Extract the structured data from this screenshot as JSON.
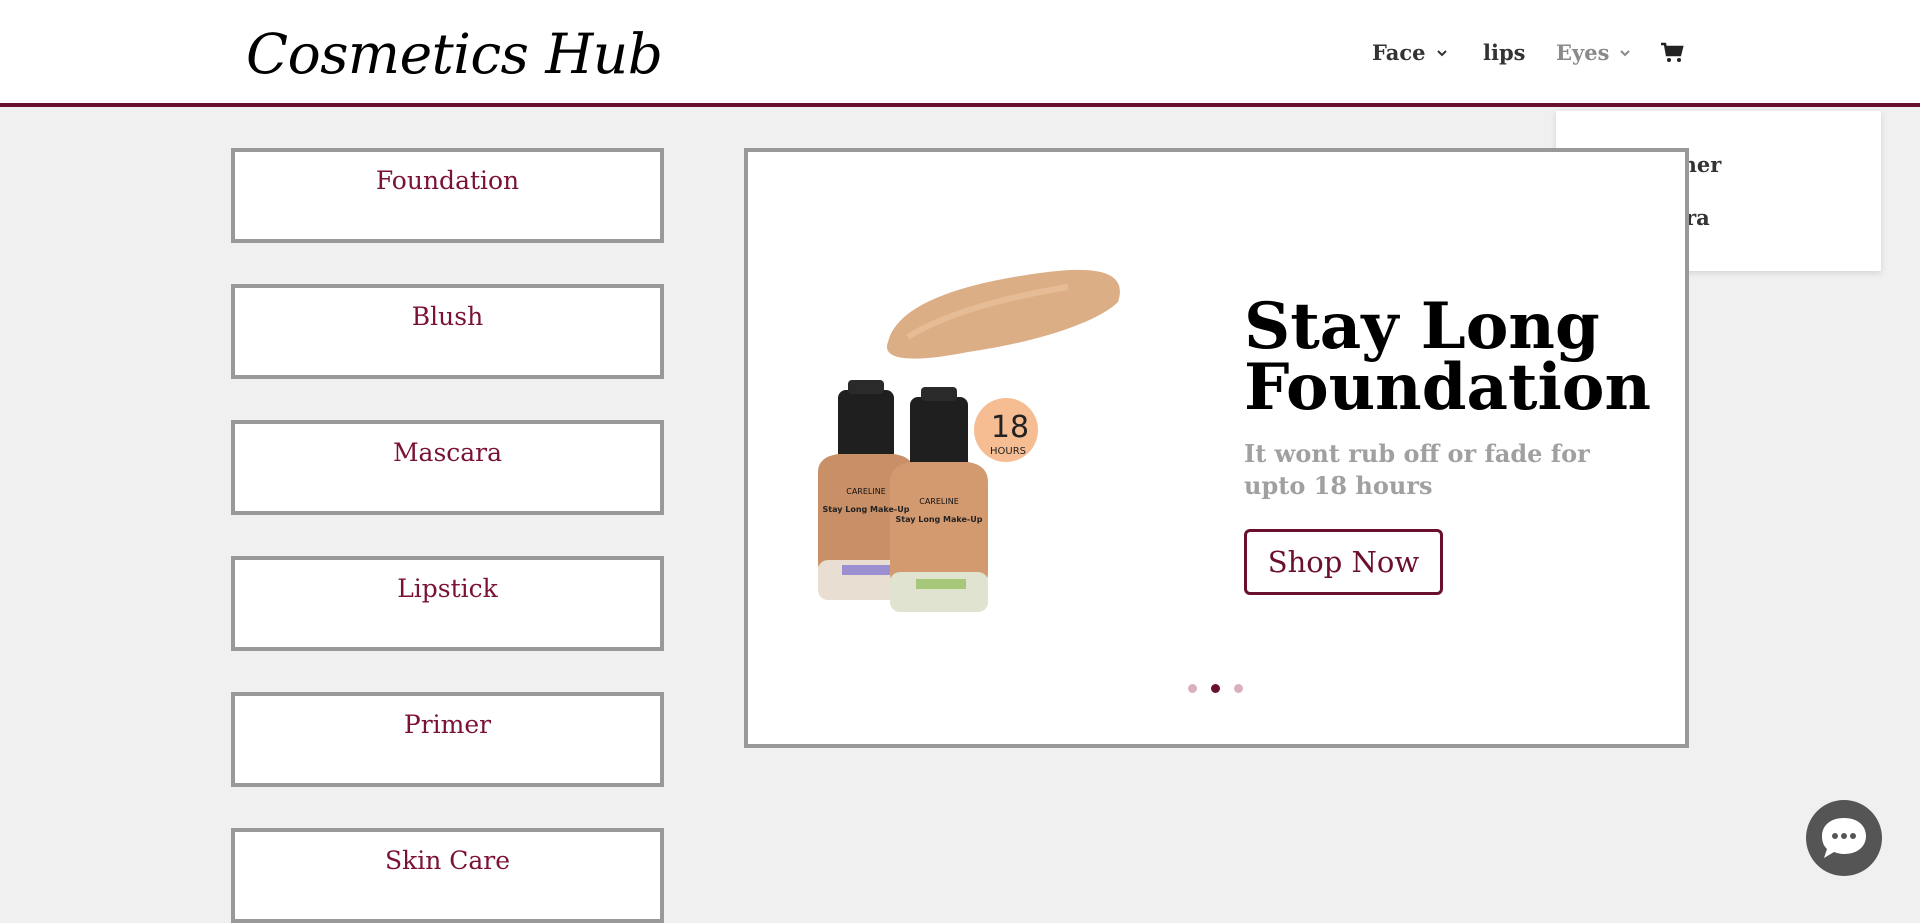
{
  "header": {
    "logo": "Cosmetics Hub",
    "nav": [
      {
        "label": "Face",
        "has_dropdown": true
      },
      {
        "label": "lips",
        "has_dropdown": false
      },
      {
        "label": "Eyes",
        "has_dropdown": true,
        "active": true
      }
    ],
    "cart_icon": "cart-icon"
  },
  "dropdown": {
    "items": [
      "Eye Liner",
      "Mascara"
    ]
  },
  "categories": [
    "Foundation",
    "Blush",
    "Mascara",
    "Lipstick",
    "Primer",
    "Skin Care"
  ],
  "slider": {
    "title": "Stay Long Foundation",
    "subtitle": "It wont rub off or fade for upto 18 hours",
    "button": "Shop Now",
    "dots": 3,
    "active_dot": 2,
    "product_image": {
      "brand": "CARELINE",
      "product": "Stay Long Make-Up",
      "badge_number": "18",
      "badge_unit": "HOURS"
    }
  },
  "colors": {
    "accent": "#6b0f2e",
    "category_text": "#7a1234",
    "border": "#999999",
    "background": "#f0f0f0"
  },
  "chat_icon": "chat-bubble-icon"
}
